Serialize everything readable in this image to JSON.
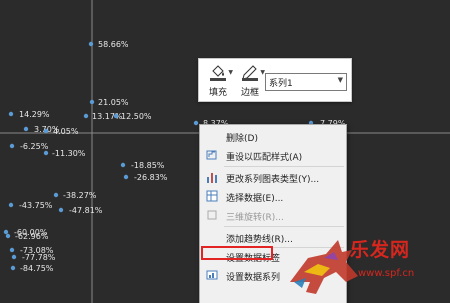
{
  "chart_data": {
    "type": "scatter",
    "points": [
      {
        "label": "58.66%"
      },
      {
        "label": "21.05%"
      },
      {
        "label": "14.29%"
      },
      {
        "label": "13.17%"
      },
      {
        "label": "12.50%"
      },
      {
        "label": "8.37%"
      },
      {
        "label": "7.79%"
      },
      {
        "label": "3.70%"
      },
      {
        "label": "4.05%"
      },
      {
        "label": "-6.25%"
      },
      {
        "label": "-11.30%"
      },
      {
        "label": "-18.85%"
      },
      {
        "label": "-26.83%"
      },
      {
        "label": "-38.27%"
      },
      {
        "label": "-43.75%"
      },
      {
        "label": "-47.81%"
      },
      {
        "label": "-60.00%"
      },
      {
        "label": "-62.96%"
      },
      {
        "label": "-73.08%"
      },
      {
        "label": "-77.78%"
      },
      {
        "label": "-84.75%"
      }
    ]
  },
  "mini_toolbar": {
    "fill_label": "填充",
    "border_label": "边框",
    "series_value": "系列1"
  },
  "context_menu": {
    "items": [
      {
        "label": "删除(D)",
        "icon": "none",
        "disabled": false
      },
      {
        "label": "重设以匹配样式(A)",
        "icon": "reset-style-icon",
        "disabled": false
      },
      {
        "label": "更改系列图表类型(Y)...",
        "icon": "chart-type-icon",
        "disabled": false
      },
      {
        "label": "选择数据(E)...",
        "icon": "select-data-icon",
        "disabled": false
      },
      {
        "label": "三维旋转(R)...",
        "icon": "rotate-3d-icon",
        "disabled": true
      },
      {
        "label": "添加趋势线(R)...",
        "icon": "none",
        "disabled": false
      },
      {
        "label": "设置数据标签",
        "icon": "none",
        "disabled": false
      },
      {
        "label": "设置数据系列",
        "icon": "format-series-icon",
        "disabled": false
      }
    ]
  },
  "watermark": {
    "text": "乐发网",
    "url": "www.spf.cn"
  },
  "colors": {
    "background": "#2b2b2b",
    "axis": "#8a8a8a",
    "marker": "#5b9bd5",
    "highlight": "#e32424",
    "watermark": "#d7261e"
  }
}
